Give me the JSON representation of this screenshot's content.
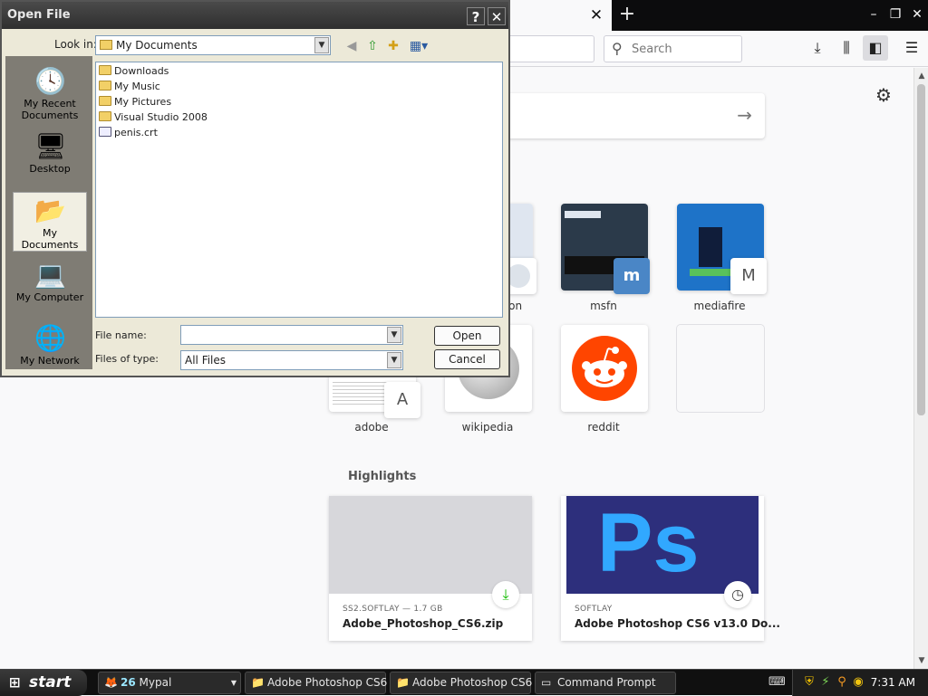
{
  "firefox": {
    "search_placeholder": "Search",
    "top_sites": [
      {
        "label": "",
        "badge": ""
      },
      {
        "label": "msfn",
        "badge": "m"
      },
      {
        "label": "mediafire",
        "badge": "M"
      },
      {
        "label": "adobe",
        "badge": "A"
      },
      {
        "label": "wikipedia",
        "badge": ""
      },
      {
        "label": "reddit",
        "badge": ""
      }
    ],
    "partial_label": "oon",
    "highlights_title": "Highlights",
    "highlights": [
      {
        "source": "SS2.SOFTLAY — 1.7 GB",
        "title": "Adobe_Photoshop_CS6.zip"
      },
      {
        "source": "SOFTLAY",
        "title": "Adobe Photoshop CS6 v13.0 Do...",
        "image_text": "Ps"
      }
    ]
  },
  "dialog": {
    "title": "Open File",
    "help": "?",
    "close": "✕",
    "look_in_label": "Look in:",
    "look_in_value": "My Documents",
    "places": [
      "My Recent Documents",
      "Desktop",
      "My Documents",
      "My Computer",
      "My Network"
    ],
    "files": [
      "Downloads",
      "My Music",
      "My Pictures",
      "Visual Studio 2008",
      "penis.crt"
    ],
    "file_name_label": "File name:",
    "file_name_value": "",
    "files_of_type_label": "Files of type:",
    "files_of_type_value": "All Files",
    "open_button": "Open",
    "cancel_button": "Cancel"
  },
  "taskbar": {
    "start": "start",
    "tasks": [
      {
        "label": "Mypal",
        "count": "26"
      },
      {
        "label": "Adobe Photoshop CS6"
      },
      {
        "label": "Adobe Photoshop CS6"
      },
      {
        "label": "Command Prompt"
      }
    ],
    "clock": "7:31 AM"
  },
  "colors": {
    "reddit": "#ff4500",
    "photoshop_bg": "#2d2f7c",
    "photoshop_text": "#31a8ff",
    "download_green": "#12bc00"
  }
}
